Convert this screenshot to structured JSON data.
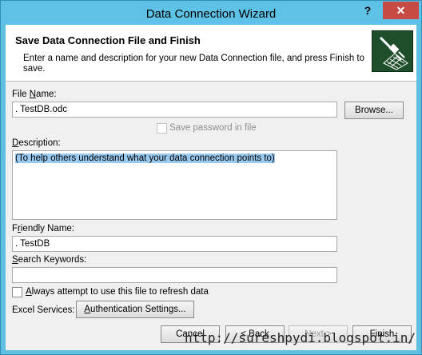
{
  "window": {
    "title": "Data Connection Wizard",
    "help_label": "?",
    "close_label": "✕"
  },
  "header": {
    "title": "Save Data Connection File and Finish",
    "description": "Enter a name and description for your new Data Connection file, and press Finish to save.",
    "icon": "data-connection-icon"
  },
  "file_name": {
    "label_pre": "File ",
    "label_key": "N",
    "label_post": "ame:",
    "value": ". TestDB.odc",
    "browse_label": "Browse..."
  },
  "save_password": {
    "label": "Save password in file",
    "checked": false,
    "enabled": false
  },
  "description": {
    "label_key": "D",
    "label_post": "escription:",
    "value": "(To help others understand what your data connection points to)"
  },
  "friendly_name": {
    "label_pre": "F",
    "label_key": "r",
    "label_post": "iendly Name:",
    "value": ". TestDB"
  },
  "search_keywords": {
    "label_key": "S",
    "label_post": "earch Keywords:",
    "value": ""
  },
  "always_attempt": {
    "label_key": "A",
    "label_post": "lways attempt to use this file to refresh data",
    "checked": false
  },
  "excel_services": {
    "label": "Excel Services:",
    "auth_key": "A",
    "auth_post": "uthentication Settings..."
  },
  "footer": {
    "cancel_label": "Cancel",
    "back_label": "< Back",
    "next_label": "Next >",
    "finish_label": "Finish"
  },
  "watermark": "http://sureshpydi.blogspot.in/"
}
